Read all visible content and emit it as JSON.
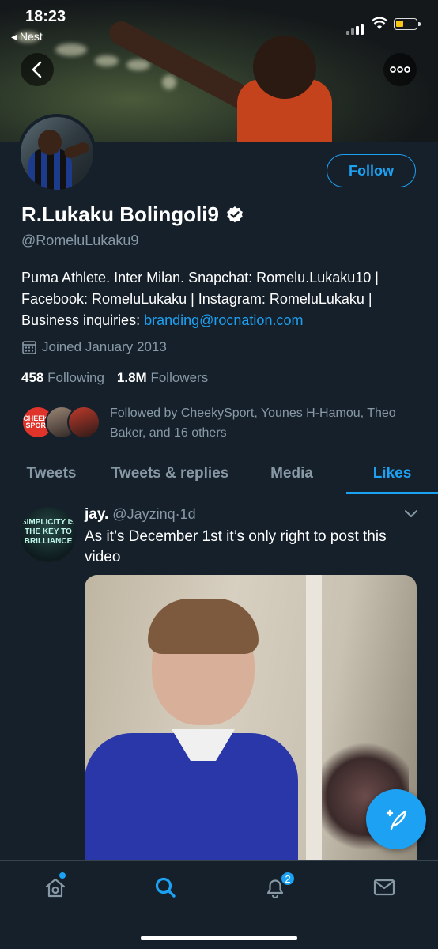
{
  "status_bar": {
    "time": "18:23",
    "back_app": "◂ Nest"
  },
  "profile": {
    "display_name": "R.Lukaku Bolingoli9",
    "handle": "@RomeluLukaku9",
    "follow_label": "Follow",
    "bio_text": "Puma Athlete. Inter Milan. Snapchat: Romelu.Lukaku10 | Facebook: RomeluLukaku | Instagram: RomeluLukaku | Business inquiries: ",
    "bio_link": "branding@rocnation.com",
    "joined": "Joined January 2013",
    "following_count": "458",
    "following_label": "Following",
    "followers_count": "1.8M",
    "followers_label": "Followers",
    "followed_by": "Followed by CheekySport, Younes H-Hamou, Theo Baker, and 16 others",
    "followed_avatar_1_text": "CHEEKY SPORT"
  },
  "tabs": [
    {
      "label": "Tweets"
    },
    {
      "label": "Tweets & replies"
    },
    {
      "label": "Media"
    },
    {
      "label": "Likes"
    }
  ],
  "tweet": {
    "author_name": "jay.",
    "author_handle": "@Jayzinq",
    "separator": "·",
    "age": "1d",
    "text": "As it’s December 1st it’s only right to post this video",
    "avatar_text": "SIMPLICITY IS THE KEY TO BRILLIANCE"
  },
  "bottom_nav": {
    "notifications_badge": "2",
    "icons": [
      "home-icon",
      "search-icon",
      "bell-icon",
      "mail-icon"
    ]
  },
  "colors": {
    "accent": "#1da1f2",
    "background": "#15202b",
    "muted": "#8899a6",
    "divider": "#38444d"
  }
}
